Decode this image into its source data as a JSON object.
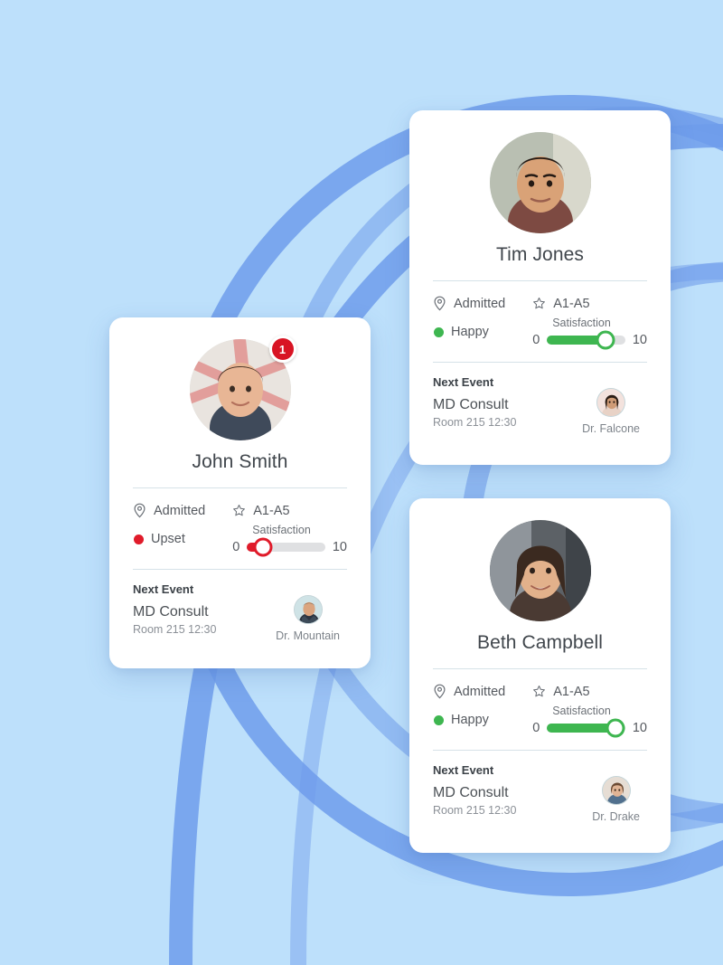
{
  "theme": {
    "background_color": "#bde0fb",
    "arc_color": "#6f9ceb",
    "card_color": "#ffffff",
    "happy_color": "#3eb650",
    "upset_color": "#e01b2a",
    "badge_color": "#d81424",
    "divider_color": "#d6e2e8"
  },
  "labels": {
    "satisfaction": "Satisfaction",
    "next_event": "Next Event",
    "scale_min": "0",
    "scale_max": "10",
    "admitted": "Admitted",
    "room_code": "A1-A5"
  },
  "cards": [
    {
      "id": "john-smith",
      "name": "John Smith",
      "badge_count": "1",
      "has_badge": true,
      "admitted_label": "Admitted",
      "room_label": "A1-A5",
      "status_label": "Upset",
      "status_color": "#e01b2a",
      "satisfaction_label": "Satisfaction",
      "satisfaction_value": 2,
      "scale_min": "0",
      "scale_max": "10",
      "event_heading": "Next Event",
      "event_title": "MD Consult",
      "event_meta": "Room 215 12:30",
      "doctor_name": "Dr. Mountain"
    },
    {
      "id": "tim-jones",
      "name": "Tim Jones",
      "badge_count": "",
      "has_badge": false,
      "admitted_label": "Admitted",
      "room_label": "A1-A5",
      "status_label": "Happy",
      "status_color": "#3eb650",
      "satisfaction_label": "Satisfaction",
      "satisfaction_value": 7.5,
      "scale_min": "0",
      "scale_max": "10",
      "event_heading": "Next Event",
      "event_title": "MD Consult",
      "event_meta": "Room 215 12:30",
      "doctor_name": "Dr. Falcone"
    },
    {
      "id": "beth-campbell",
      "name": "Beth Campbell",
      "badge_count": "",
      "has_badge": false,
      "admitted_label": "Admitted",
      "room_label": "A1-A5",
      "status_label": "Happy",
      "status_color": "#3eb650",
      "satisfaction_label": "Satisfaction",
      "satisfaction_value": 8.8,
      "scale_min": "0",
      "scale_max": "10",
      "event_heading": "Next Event",
      "event_title": "MD Consult",
      "event_meta": "Room 215 12:30",
      "doctor_name": "Dr. Drake"
    }
  ],
  "icons": {
    "location": "map-pin-icon",
    "room": "star-icon",
    "status": "status-dot-icon"
  }
}
